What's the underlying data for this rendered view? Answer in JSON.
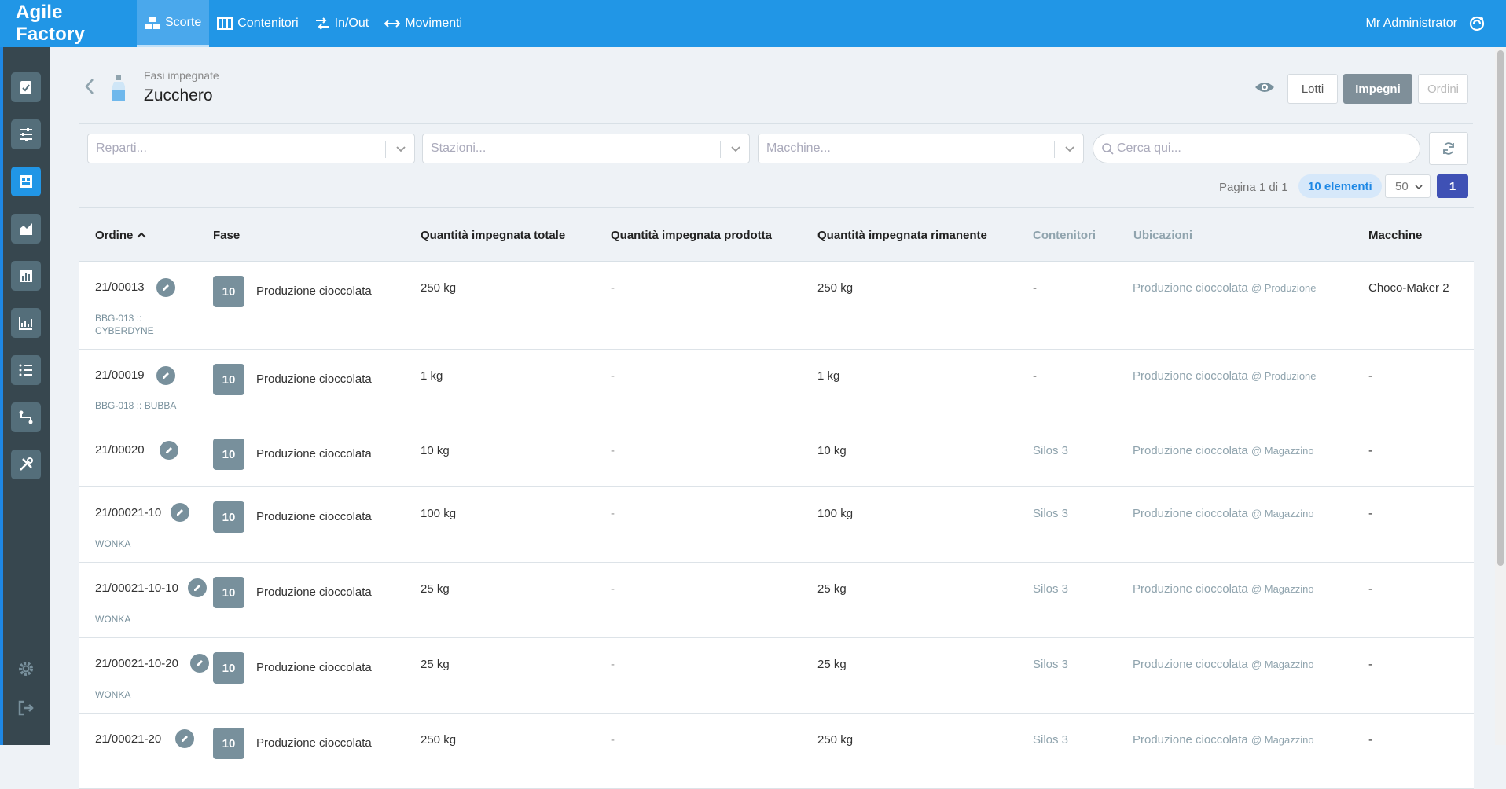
{
  "app": {
    "brand": "Agile Factory",
    "user": "Mr Administrator"
  },
  "nav": [
    {
      "label": "Scorte",
      "icon": "boxes-icon",
      "active": true
    },
    {
      "label": "Contenitori",
      "icon": "containers-icon",
      "active": false
    },
    {
      "label": "In/Out",
      "icon": "in-out-icon",
      "active": false
    },
    {
      "label": "Movimenti",
      "icon": "arrows-icon",
      "active": false
    }
  ],
  "header": {
    "breadcrumb": "Fasi impegnate",
    "title": "Zucchero"
  },
  "view_buttons": {
    "lotti": "Lotti",
    "impegni": "Impegni",
    "ordini": "Ordini"
  },
  "filters": {
    "reparti": "Reparti...",
    "stazioni": "Stazioni...",
    "macchine": "Macchine...",
    "search": "Cerca qui..."
  },
  "pagination": {
    "text": "Pagina 1 di 1",
    "count": "10 elementi",
    "per_page": "50",
    "page": "1"
  },
  "columns": {
    "ordine": "Ordine",
    "fase": "Fase",
    "qt_totale": "Quantità impegnata totale",
    "qt_prodotta": "Quantità impegnata prodotta",
    "qt_rimanente": "Quantità impegnata rimanente",
    "contenitori": "Contenitori",
    "ubicazioni": "Ubicazioni",
    "macchine": "Macchine"
  },
  "rows": [
    {
      "ordine": "21/00013",
      "sub": "BBG-013 :: CYBERDYNE",
      "fase_num": "10",
      "fase": "Produzione cioccolata",
      "totale": "250 kg",
      "prodotta": "-",
      "rimanente": "250 kg",
      "contenitori": "-",
      "ubicazione": "Produzione cioccolata",
      "ubic_luogo": "@ Produzione",
      "macchine": "Choco-Maker 2"
    },
    {
      "ordine": "21/00019",
      "sub": "BBG-018 :: BUBBA",
      "fase_num": "10",
      "fase": "Produzione cioccolata",
      "totale": "1 kg",
      "prodotta": "-",
      "rimanente": "1 kg",
      "contenitori": "-",
      "ubicazione": "Produzione cioccolata",
      "ubic_luogo": "@ Produzione",
      "macchine": "-"
    },
    {
      "ordine": "21/00020",
      "sub": "",
      "fase_num": "10",
      "fase": "Produzione cioccolata",
      "totale": "10 kg",
      "prodotta": "-",
      "rimanente": "10 kg",
      "contenitori": "Silos 3",
      "ubicazione": "Produzione cioccolata",
      "ubic_luogo": "@ Magazzino",
      "macchine": "-"
    },
    {
      "ordine": "21/00021-10",
      "sub": "WONKA",
      "fase_num": "10",
      "fase": "Produzione cioccolata",
      "totale": "100 kg",
      "prodotta": "-",
      "rimanente": "100 kg",
      "contenitori": "Silos 3",
      "ubicazione": "Produzione cioccolata",
      "ubic_luogo": "@ Magazzino",
      "macchine": "-"
    },
    {
      "ordine": "21/00021-10-10",
      "sub": "WONKA",
      "fase_num": "10",
      "fase": "Produzione cioccolata",
      "totale": "25 kg",
      "prodotta": "-",
      "rimanente": "25 kg",
      "contenitori": "Silos 3",
      "ubicazione": "Produzione cioccolata",
      "ubic_luogo": "@ Magazzino",
      "macchine": "-"
    },
    {
      "ordine": "21/00021-10-20",
      "sub": "WONKA",
      "fase_num": "10",
      "fase": "Produzione cioccolata",
      "totale": "25 kg",
      "prodotta": "-",
      "rimanente": "25 kg",
      "contenitori": "Silos 3",
      "ubicazione": "Produzione cioccolata",
      "ubic_luogo": "@ Magazzino",
      "macchine": "-"
    },
    {
      "ordine": "21/00021-20",
      "sub": "",
      "fase_num": "10",
      "fase": "Produzione cioccolata",
      "totale": "250 kg",
      "prodotta": "-",
      "rimanente": "250 kg",
      "contenitori": "Silos 3",
      "ubicazione": "Produzione cioccolata",
      "ubic_luogo": "@ Magazzino",
      "macchine": "-"
    }
  ],
  "colors": {
    "primary": "#2196e6",
    "sidebar": "#37474f",
    "badge": "#78909c",
    "page_active": "#3f51b5"
  }
}
